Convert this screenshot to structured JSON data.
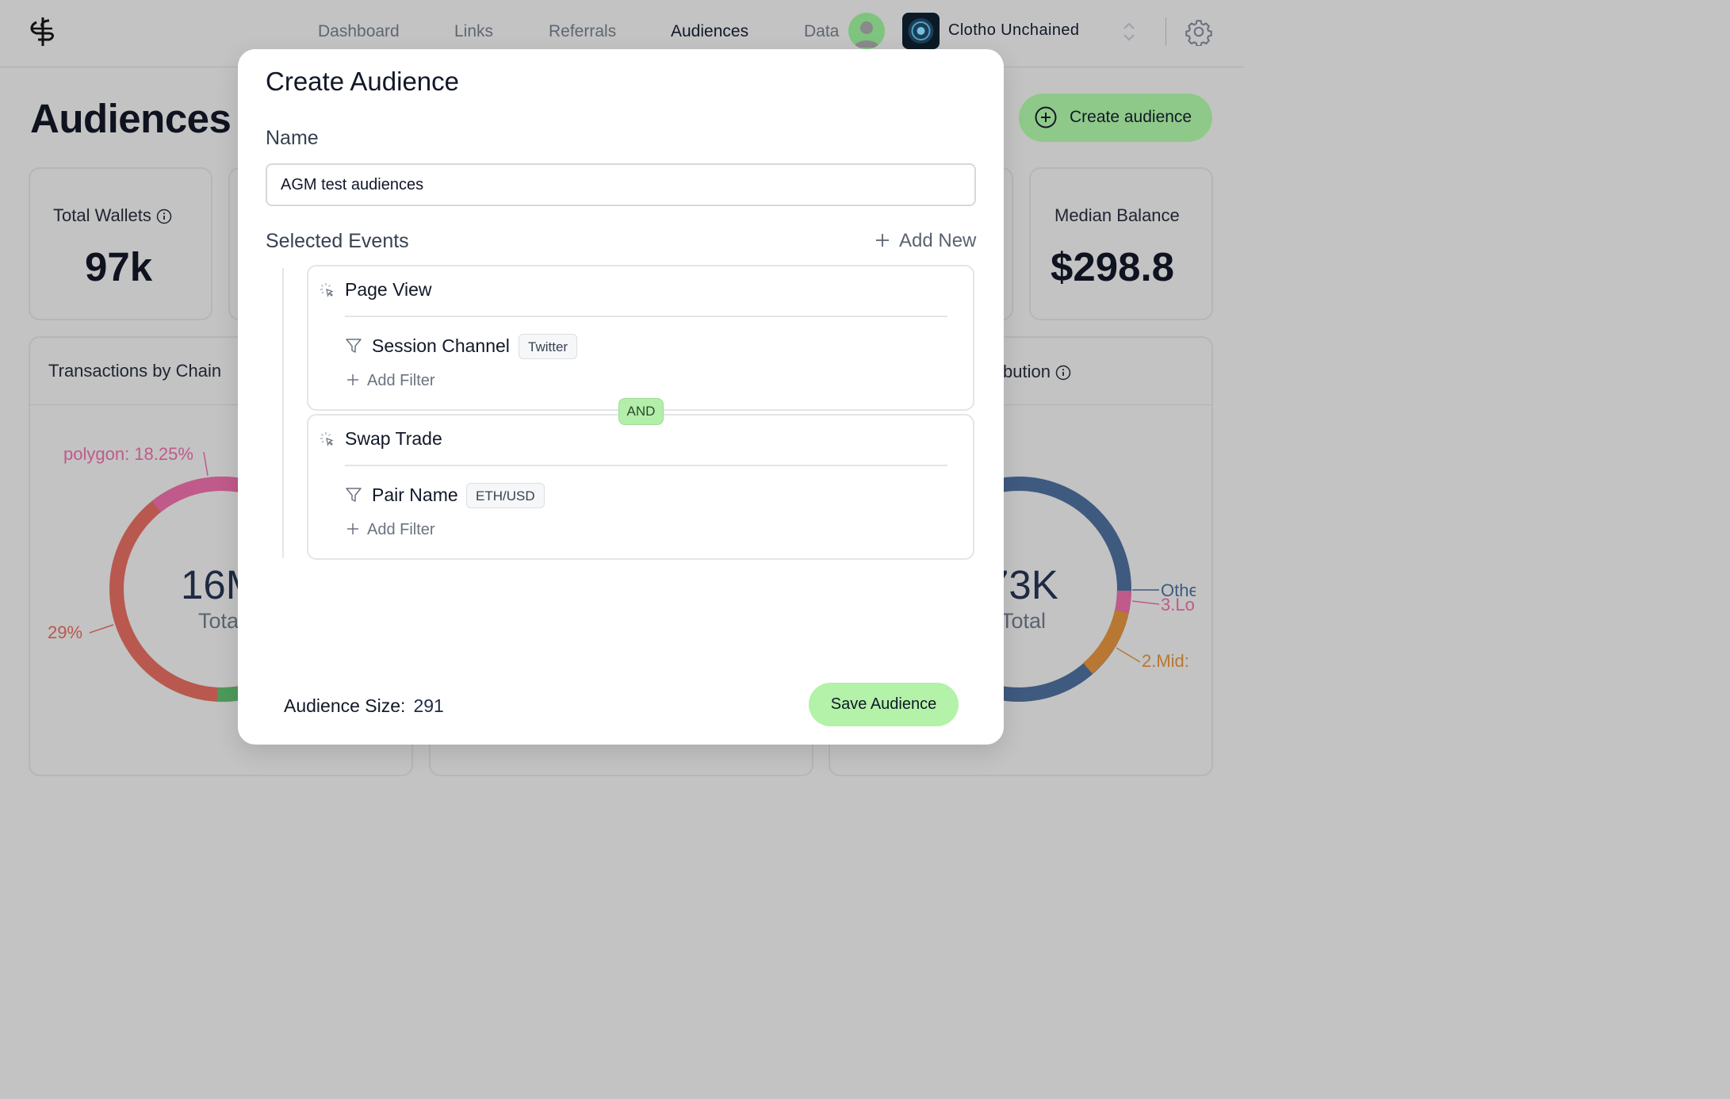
{
  "nav": {
    "items": [
      "Dashboard",
      "Links",
      "Referrals",
      "Audiences",
      "Data"
    ],
    "active": "Audiences"
  },
  "project": {
    "name": "Clotho Unchained"
  },
  "page": {
    "title": "Audiences",
    "create_button": "Create audience"
  },
  "stats": {
    "total_wallets_label": "Total Wallets",
    "total_wallets_value": "97k",
    "median_balance_label": "Median Balance",
    "median_balance_value": "$298.8"
  },
  "charts": {
    "left": {
      "title": "Transactions by Chain",
      "center_value": "16M",
      "center_label": "Total",
      "labels": [
        "polygon: 18.25%",
        "29%"
      ]
    },
    "right": {
      "title_fragment": "bution",
      "center_value": "73K",
      "center_label": "Total",
      "labels": [
        "Othe",
        "3.Lo",
        "2.Mid:"
      ]
    }
  },
  "modal": {
    "title": "Create Audience",
    "name_label": "Name",
    "name_value": "AGM test audiences",
    "selected_events_label": "Selected Events",
    "add_new": "Add New",
    "events": [
      {
        "title": "Page View",
        "filter_name": "Session Channel",
        "filter_value": "Twitter",
        "add_filter": "Add Filter"
      },
      {
        "title": "Swap Trade",
        "filter_name": "Pair Name",
        "filter_value": "ETH/USD",
        "add_filter": "Add Filter"
      }
    ],
    "connector": "AND",
    "audience_size_label": "Audience Size:",
    "audience_size_value": "291",
    "save_button": "Save Audience"
  },
  "colors": {
    "overlay_bg": "#c3c3c3",
    "accent_green": "#b3f2a8",
    "create_green": "#8fc98a",
    "donut_red": "#b9584e",
    "donut_pink": "#c05a8a",
    "donut_green": "#4e9a5a",
    "donut_blue": "#3f5a7f",
    "donut_orange": "#b87732"
  }
}
